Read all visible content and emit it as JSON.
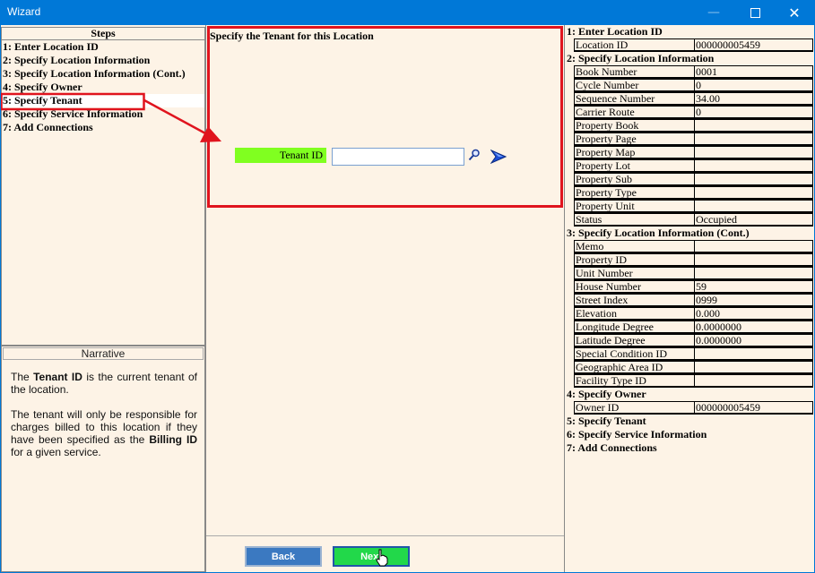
{
  "window": {
    "title": "Wizard"
  },
  "steps": {
    "header": "Steps",
    "items": [
      {
        "label": "1: Enter Location ID"
      },
      {
        "label": "2: Specify Location Information"
      },
      {
        "label": "3: Specify Location Information (Cont.)"
      },
      {
        "label": "4: Specify Owner"
      },
      {
        "label": "5: Specify Tenant",
        "active": true
      },
      {
        "label": "6: Specify Service Information"
      },
      {
        "label": "7: Add Connections"
      }
    ]
  },
  "narrative": {
    "header": "Narrative",
    "p1_pre": "The",
    "p1_bold": "Tenant ID",
    "p1_post": "is the current tenant of the location.",
    "p2_pre": "The tenant will only be responsible for charges billed to this location if they have been specified as the",
    "p2_bold": "Billing ID",
    "p2_post": "for a given service."
  },
  "main": {
    "title": "Specify the Tenant for this Location",
    "tenant_label": "Tenant ID",
    "tenant_value": ""
  },
  "buttons": {
    "back": "Back",
    "next": "Next"
  },
  "summary": [
    {
      "section": "1: Enter Location ID",
      "fields": [
        {
          "k": "Location ID",
          "v": "000000005459"
        }
      ]
    },
    {
      "section": "2: Specify Location Information",
      "fields": [
        {
          "k": "Book Number",
          "v": "0001"
        },
        {
          "k": "Cycle Number",
          "v": "0"
        },
        {
          "k": "Sequence Number",
          "v": "34.00"
        },
        {
          "k": "Carrier Route",
          "v": "0"
        },
        {
          "k": "Property Book",
          "v": ""
        },
        {
          "k": "Property Page",
          "v": ""
        },
        {
          "k": "Property Map",
          "v": ""
        },
        {
          "k": "Property Lot",
          "v": ""
        },
        {
          "k": "Property Sub",
          "v": ""
        },
        {
          "k": "Property Type",
          "v": ""
        },
        {
          "k": "Property Unit",
          "v": ""
        },
        {
          "k": "Status",
          "v": "Occupied"
        }
      ]
    },
    {
      "section": "3: Specify Location Information (Cont.)",
      "fields": [
        {
          "k": "Memo",
          "v": ""
        },
        {
          "k": "Property ID",
          "v": ""
        },
        {
          "k": "Unit Number",
          "v": ""
        },
        {
          "k": "House Number",
          "v": "59"
        },
        {
          "k": "Street Index",
          "v": "0999"
        },
        {
          "k": "Elevation",
          "v": "0.000"
        },
        {
          "k": "Longitude Degree",
          "v": "0.0000000"
        },
        {
          "k": "Latitude Degree",
          "v": "0.0000000"
        },
        {
          "k": "Special Condition ID",
          "v": ""
        },
        {
          "k": "Geographic Area ID",
          "v": ""
        },
        {
          "k": "Facility Type ID",
          "v": ""
        }
      ]
    },
    {
      "section": "4: Specify Owner",
      "fields": [
        {
          "k": "Owner  ID",
          "v": "000000005459"
        }
      ]
    },
    {
      "section": "5: Specify Tenant",
      "fields": []
    },
    {
      "section": "6: Specify Service Information",
      "fields": []
    },
    {
      "section": "7: Add Connections",
      "fields": []
    }
  ],
  "colors": {
    "titlebar": "#0078d7",
    "background": "#fdf3e6",
    "highlight": "#e0141e",
    "tenant_label_bg": "#80ff20",
    "next_button": "#22d84a",
    "back_button": "#3b79c1"
  }
}
